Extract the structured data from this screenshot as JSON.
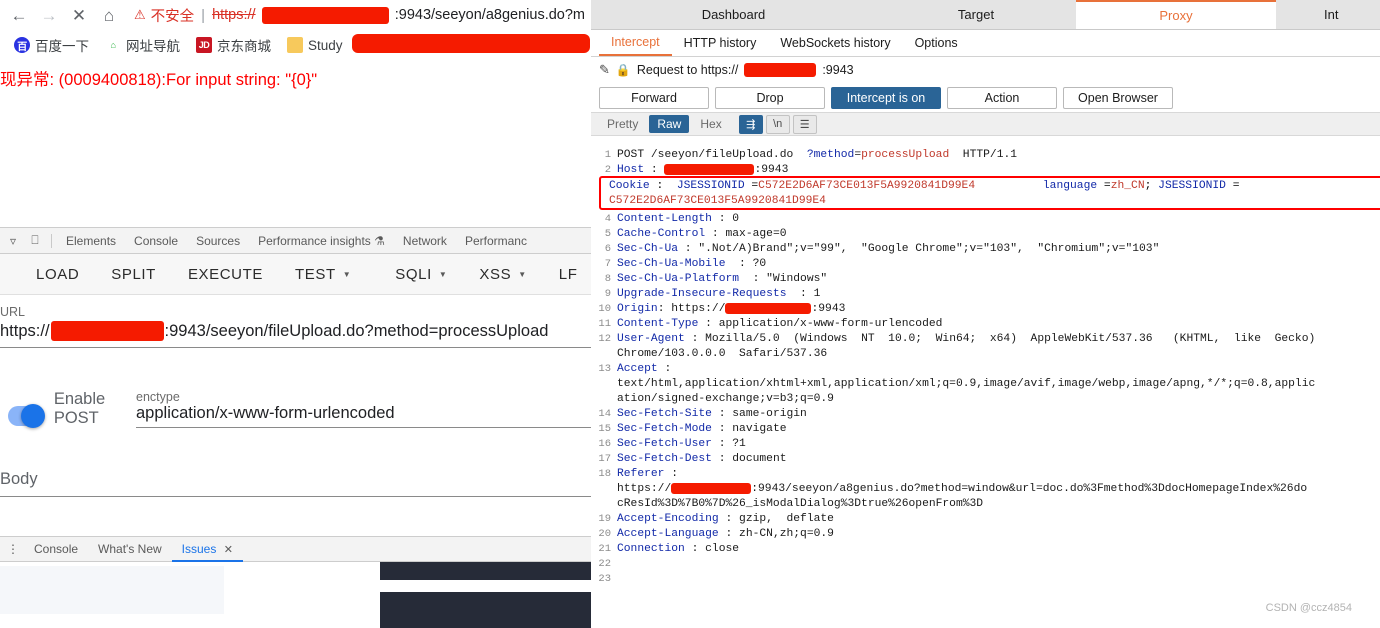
{
  "browser": {
    "nav": {
      "back": "←",
      "forward": "→",
      "stop": "✕",
      "home": "⌂"
    },
    "omnibox": {
      "warning_icon": "⚠",
      "warning_text": "不安全",
      "separator": "|",
      "scheme": "https://",
      "url_after_redaction": ":9943/seeyon/a8genius.do?m"
    },
    "bookmarks": [
      {
        "icon": "baidu-icon",
        "glyph": "百",
        "label": "百度一下"
      },
      {
        "icon": "navsite-icon",
        "glyph": "⌂",
        "label": "网址导航"
      },
      {
        "icon": "jd-icon",
        "glyph": "JD",
        "label": "京东商城"
      },
      {
        "icon": "folder-icon",
        "glyph": "",
        "label": "Study"
      }
    ],
    "page_error": "现异常: (0009400818):For input string: \"{0}\""
  },
  "devtools": {
    "tabs": [
      "Elements",
      "Console",
      "Sources",
      "Performance insights",
      "Network",
      "Performanc"
    ],
    "performance_insights_badge": "⚗",
    "drawer_tabs": [
      {
        "label": "Console",
        "active": false
      },
      {
        "label": "What's New",
        "active": false
      },
      {
        "label": "Issues",
        "active": true,
        "close": "✕"
      }
    ]
  },
  "hackbar": {
    "buttons": [
      {
        "label": "LOAD",
        "caret": false
      },
      {
        "label": "SPLIT",
        "caret": false
      },
      {
        "label": "EXECUTE",
        "caret": false
      },
      {
        "label": "TEST",
        "caret": true
      },
      {
        "label": "SQLI",
        "caret": true
      },
      {
        "label": "XSS",
        "caret": true
      },
      {
        "label": "LF",
        "caret": false
      }
    ],
    "url_label": "URL",
    "url_scheme": "https://",
    "url_rest": ":9943/seeyon/fileUpload.do?method=processUpload",
    "enable_post_label": "Enable POST",
    "post_enabled": true,
    "enctype_label": "enctype",
    "enctype_value": "application/x-www-form-urlencoded",
    "body_label": "Body",
    "body_value": ""
  },
  "burp": {
    "top_tabs": [
      {
        "label": "Dashboard",
        "active": false
      },
      {
        "label": "Target",
        "active": false
      },
      {
        "label": "Proxy",
        "active": true
      },
      {
        "label": "Int",
        "active": false
      }
    ],
    "sub_tabs": [
      {
        "label": "Intercept",
        "active": true
      },
      {
        "label": "HTTP history",
        "active": false
      },
      {
        "label": "WebSockets history",
        "active": false
      },
      {
        "label": "Options",
        "active": false
      }
    ],
    "request_to_prefix": "Request to https://",
    "request_to_suffix": ":9943",
    "lock_icon": "🔒",
    "pencil_icon": "✎",
    "action_buttons": [
      {
        "label": "Forward",
        "primary": false
      },
      {
        "label": "Drop",
        "primary": false
      },
      {
        "label": "Intercept is on",
        "primary": true
      },
      {
        "label": "Action",
        "primary": false
      },
      {
        "label": "Open Browser",
        "primary": false
      }
    ],
    "view_tabs": [
      {
        "label": "Pretty",
        "selected": false
      },
      {
        "label": "Raw",
        "selected": true
      },
      {
        "label": "Hex",
        "selected": false
      }
    ],
    "view_icons": [
      {
        "name": "word-wrap-icon",
        "glyph": "⇶",
        "selected": true
      },
      {
        "name": "show-newlines-icon",
        "glyph": "\\n",
        "selected": false
      },
      {
        "name": "menu-icon",
        "glyph": "☰",
        "selected": false
      }
    ],
    "request_lines": [
      {
        "n": "1",
        "type": "request",
        "method": "POST",
        "path": "/seeyon/fileUpload.do",
        "query_key": "?method",
        "eq": "=",
        "query_val": "processUpload",
        "proto": "HTTP/1.1"
      },
      {
        "n": "2",
        "type": "redacted_header",
        "name": "Host",
        "suffix": ":9943"
      },
      {
        "n": "3",
        "type": "cookie",
        "name": "Cookie",
        "key1": "JSESSIONID",
        "val1": "C572E2D6AF73CE013F5A9920841D99E4",
        "key2": "language",
        "val2": "zh_CN",
        "key3": "JSESSIONID",
        "val3": "C572E2D6AF73CE013F5A9920841D99E4"
      },
      {
        "n": "4",
        "type": "header",
        "name": "Content-Length",
        "value": "0"
      },
      {
        "n": "5",
        "type": "header",
        "name": "Cache-Control",
        "value": "max-age=0"
      },
      {
        "n": "6",
        "type": "header",
        "name": "Sec-Ch-Ua",
        "value": "\".Not/A)Brand\";v=\"99\",  \"Google Chrome\";v=\"103\",  \"Chromium\";v=\"103\""
      },
      {
        "n": "7",
        "type": "header",
        "name": "Sec-Ch-Ua-Mobile",
        "value": "?0"
      },
      {
        "n": "8",
        "type": "header",
        "name": "Sec-Ch-Ua-Platform",
        "value": "\"Windows\""
      },
      {
        "n": "9",
        "type": "header",
        "name": "Upgrade-Insecure-Requests",
        "value": "1"
      },
      {
        "n": "10",
        "type": "redacted_value",
        "name": "Origin",
        "prefix": "https://",
        "suffix": ":9943"
      },
      {
        "n": "11",
        "type": "header",
        "name": "Content-Type",
        "value": "application/x-www-form-urlencoded"
      },
      {
        "n": "12",
        "type": "header_wrap",
        "name": "User-Agent",
        "value": "Mozilla/5.0  (Windows  NT  10.0;  Win64;  x64)  AppleWebKit/537.36   (KHTML,  like  Gecko)",
        "cont": "Chrome/103.0.0.0  Safari/537.36"
      },
      {
        "n": "13",
        "type": "header_only_wrap",
        "name": "Accept",
        "cont1": "text/html,application/xhtml+xml,application/xml;q=0.9,image/avif,image/webp,image/apng,*/*;q=0.8,applic",
        "cont2": "ation/signed-exchange;v=b3;q=0.9"
      },
      {
        "n": "14",
        "type": "header",
        "name": "Sec-Fetch-Site",
        "value": "same-origin"
      },
      {
        "n": "15",
        "type": "header",
        "name": "Sec-Fetch-Mode",
        "value": "navigate"
      },
      {
        "n": "16",
        "type": "header",
        "name": "Sec-Fetch-User",
        "value": "?1"
      },
      {
        "n": "17",
        "type": "header",
        "name": "Sec-Fetch-Dest",
        "value": "document"
      },
      {
        "n": "18",
        "type": "referer",
        "name": "Referer",
        "prefix": "https://",
        "cont1": ":9943/seeyon/a8genius.do?method=window&url=doc.do%3Fmethod%3DdocHomepageIndex%26do",
        "cont2": "cResId%3D%7B0%7D%26_isModalDialog%3Dtrue%26openFrom%3D"
      },
      {
        "n": "19",
        "type": "header",
        "name": "Accept-Encoding",
        "value": "gzip,  deflate"
      },
      {
        "n": "20",
        "type": "header",
        "name": "Accept-Language",
        "value": "zh-CN,zh;q=0.9"
      },
      {
        "n": "21",
        "type": "header",
        "name": "Connection",
        "value": "close"
      },
      {
        "n": "22",
        "type": "blank"
      },
      {
        "n": "23",
        "type": "blank"
      }
    ]
  },
  "watermark": "CSDN @ccz4854",
  "colors": {
    "accent_orange": "#e8713a",
    "burp_blue": "#2a6496",
    "error_red": "#ff0000",
    "redaction": "#f51b00",
    "chrome_blue": "#1a73e8"
  }
}
